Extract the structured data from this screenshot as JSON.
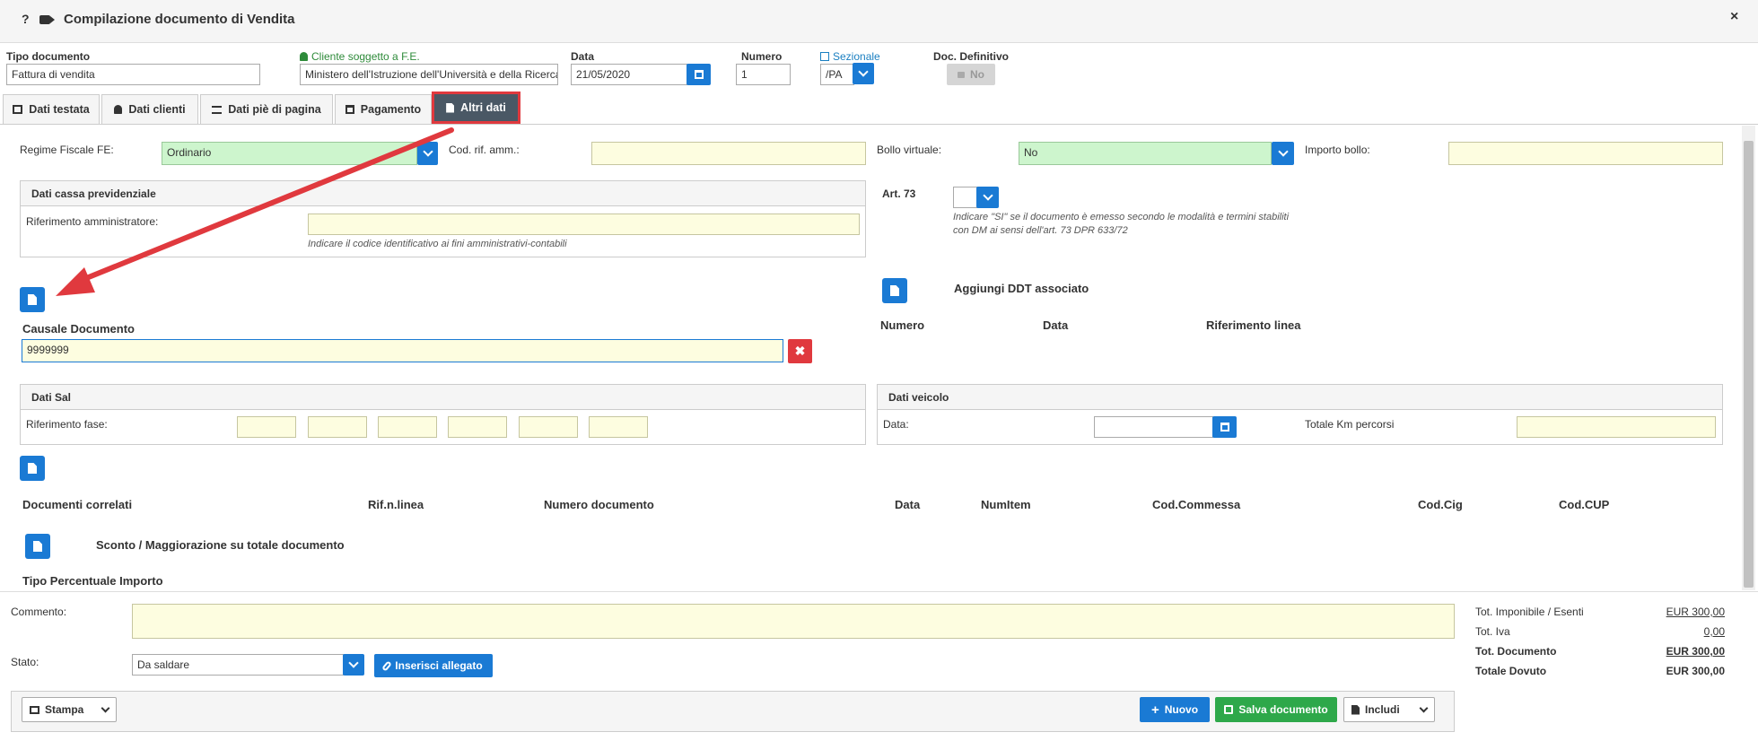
{
  "window": {
    "title": "Compilazione documento di Vendita",
    "help": "?",
    "close": "×"
  },
  "header": {
    "tipo_label": "Tipo documento",
    "tipo_value": "Fattura di vendita",
    "cliente_label": "Cliente soggetto a F.E.",
    "cliente_value": "Ministero dell'Istruzione dell'Università e della Ricerca",
    "data_label": "Data",
    "data_value": "21/05/2020",
    "numero_label": "Numero",
    "numero_value": "1",
    "sezionale_label": "Sezionale",
    "sezionale_value": "/PA",
    "definitivo_label": "Doc. Definitivo",
    "definitivo_value": "No"
  },
  "tabs": [
    {
      "label": "Dati testata"
    },
    {
      "label": "Dati clienti"
    },
    {
      "label": "Dati piè di pagina"
    },
    {
      "label": "Pagamento"
    },
    {
      "label": "Altri dati"
    }
  ],
  "form": {
    "regime_label": "Regime Fiscale FE:",
    "regime_value": "Ordinario",
    "codrif_label": "Cod. rif. amm.:",
    "bollo_label": "Bollo virtuale:",
    "bollo_value": "No",
    "importo_bollo_label": "Importo bollo:",
    "cassa_title": "Dati cassa previdenziale",
    "rif_amm_label": "Riferimento amministratore:",
    "rif_amm_note": "Indicare il codice identificativo ai fini amministrativi-contabili",
    "art73_label": "Art. 73",
    "art73_note": "Indicare \"SI\" se il documento è emesso secondo le modalità e termini stabiliti con DM ai sensi dell'art. 73 DPR 633/72",
    "ddt_title": "Aggiungi DDT associato",
    "ddt_cols": [
      "Numero",
      "Data",
      "Riferimento linea"
    ],
    "causale_label": "Causale Documento",
    "causale_value": "9999999",
    "sal_title": "Dati Sal",
    "sal_rif_label": "Riferimento fase:",
    "veicolo_title": "Dati veicolo",
    "veicolo_data_label": "Data:",
    "veicolo_km_label": "Totale Km percorsi",
    "correlati_cols": [
      "Documenti correlati",
      "Rif.n.linea",
      "Numero documento",
      "Data",
      "NumItem",
      "Cod.Commessa",
      "Cod.Cig",
      "Cod.CUP"
    ],
    "sconto_title": "Sconto / Maggiorazione su totale documento",
    "sconto_cols": "Tipo Percentuale Importo"
  },
  "bottom": {
    "commento_label": "Commento:",
    "stato_label": "Stato:",
    "stato_value": "Da saldare",
    "allegato_label": "Inserisci allegato"
  },
  "totals": [
    {
      "label": "Tot. Imponibile / Esenti",
      "value": "EUR 300,00"
    },
    {
      "label": "Tot. Iva",
      "value": "0,00"
    },
    {
      "label": "Tot. Documento",
      "value": "EUR 300,00"
    },
    {
      "label": "Totale Dovuto",
      "value": "EUR 300,00"
    }
  ],
  "footer": {
    "stampa": "Stampa",
    "nuovo": "Nuovo",
    "salva": "Salva documento",
    "includi": "Includi"
  },
  "colors": {
    "accent_blue": "#1a7ad4",
    "active_tab": "#4a5865",
    "highlight_red": "#e0393e",
    "save_green": "#2ea84a"
  }
}
